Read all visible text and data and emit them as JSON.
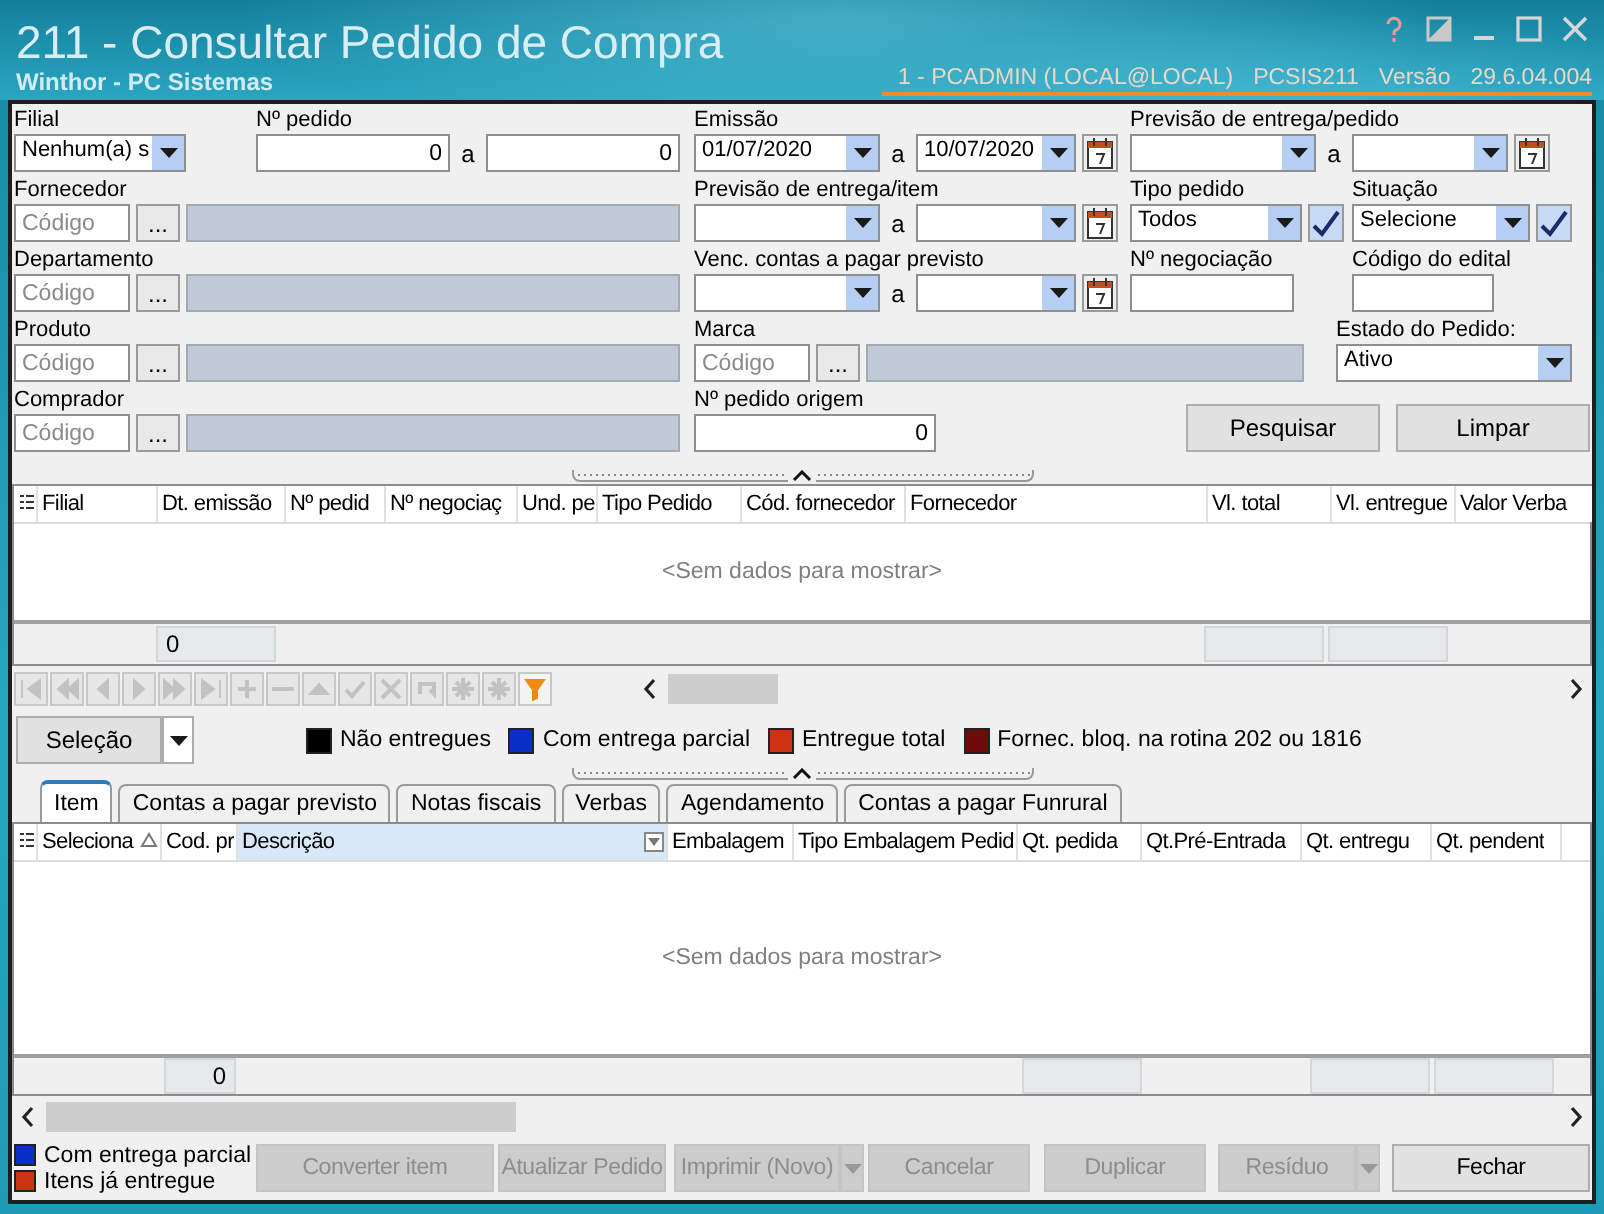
{
  "window": {
    "title": "211 - Consultar Pedido de Compra",
    "subtitle": "Winthor - PC Sistemas",
    "session": "1 - PCADMIN (LOCAL@LOCAL)",
    "program": "PCSIS211",
    "version_label": "Versão",
    "version": "29.6.04.004"
  },
  "filters": {
    "rows": [
      [
        {
          "kind": "combo",
          "label": "Filial",
          "value": "Nenhum(a) s"
        },
        {
          "kind": "number_range",
          "label": "Nº pedido",
          "from": "0",
          "separator": "a",
          "to": "0"
        },
        {
          "kind": "date_range",
          "label": "Emissão",
          "from": "01/07/2020",
          "separator": "a",
          "to": "10/07/2020"
        },
        {
          "kind": "date_range",
          "label": "Previsão de entrega/pedido",
          "separator": "a"
        }
      ],
      [
        {
          "kind": "lookup",
          "label": "Fornecedor",
          "placeholder": "Código",
          "button": "..."
        },
        "",
        {
          "kind": "date_range",
          "label": "Previsão de entrega/item",
          "separator": "a"
        },
        {
          "kind": "combo_check",
          "label": "Tipo pedido",
          "value": "Todos"
        },
        {
          "kind": "combo_check",
          "label": "Situação",
          "value": "Selecione"
        }
      ],
      [
        {
          "kind": "lookup",
          "label": "Departamento",
          "placeholder": "Código",
          "button": "..."
        },
        "",
        {
          "kind": "date_range",
          "label": "Venc. contas a  pagar previsto",
          "separator": "a"
        },
        {
          "kind": "text",
          "label": "Nº negociação"
        },
        {
          "kind": "text",
          "label": "Código do edital"
        }
      ],
      [
        {
          "kind": "lookup",
          "label": "Produto",
          "placeholder": "Código",
          "button": "..."
        },
        "",
        {
          "kind": "lookup",
          "label": "Marca",
          "placeholder": "Código",
          "button": "..."
        },
        {
          "kind": "combo",
          "label": "Estado do Pedido:",
          "value": "Ativo"
        }
      ],
      [
        {
          "kind": "lookup",
          "label": "Comprador",
          "placeholder": "Código",
          "button": "..."
        },
        "",
        {
          "kind": "number",
          "label": "Nº pedido origem",
          "value": "0"
        },
        {
          "kind": "button",
          "label": "Pesquisar"
        },
        {
          "kind": "button",
          "label": "Limpar"
        }
      ]
    ]
  },
  "orders_grid": {
    "columns": [
      "Filial",
      "Dt. emissão",
      "Nº pedid",
      "Nº negociaç",
      "Und. pe",
      "Tipo Pedido",
      "Cód. fornecedor",
      "Fornecedor",
      "Vl. total",
      "Vl. entregue",
      "Valor Verba"
    ],
    "empty_text": "<Sem dados para mostrar>",
    "count": "0"
  },
  "navigator": {
    "buttons": [
      {
        "kind": "first",
        "disabled": true
      },
      {
        "kind": "prior_page",
        "disabled": true
      },
      {
        "kind": "prior",
        "disabled": true
      },
      {
        "kind": "next",
        "disabled": true
      },
      {
        "kind": "next_page",
        "disabled": true
      },
      {
        "kind": "last",
        "disabled": true
      },
      {
        "kind": "insert",
        "disabled": true
      },
      {
        "kind": "delete",
        "disabled": true
      },
      {
        "kind": "edit",
        "disabled": true
      },
      {
        "kind": "post",
        "disabled": true
      },
      {
        "kind": "cancel",
        "disabled": true
      },
      {
        "kind": "refresh",
        "disabled": true
      },
      {
        "kind": "bookmark",
        "disabled": true
      },
      {
        "kind": "goto_bookmark",
        "disabled": true
      },
      {
        "kind": "filter",
        "disabled": false
      }
    ]
  },
  "selection_button": "Seleção",
  "legend": [
    {
      "label": "Não entregues",
      "color": "#000000"
    },
    {
      "label": "Com entrega parcial",
      "color": "#0a2fc8"
    },
    {
      "label": "Entregue total",
      "color": "#cc3311"
    },
    {
      "label": "Fornec. bloq. na rotina 202 ou 1816",
      "color": "#6e0c0c"
    }
  ],
  "tabs": [
    {
      "label": "Item",
      "selected": true
    },
    {
      "label": "Contas a pagar previsto",
      "selected": false
    },
    {
      "label": "Notas fiscais",
      "selected": false
    },
    {
      "label": "Verbas",
      "selected": false
    },
    {
      "label": "Agendamento",
      "selected": false
    },
    {
      "label": "Contas a pagar Funrural",
      "selected": false
    }
  ],
  "items_grid": {
    "columns": [
      {
        "label": "Seleciona",
        "sorted": true,
        "highlighted": false
      },
      {
        "label": "Cod. pr",
        "sorted": false,
        "highlighted": false
      },
      {
        "label": "Descrição",
        "sorted": false,
        "highlighted": true
      },
      {
        "label": "Embalagem",
        "sorted": false,
        "highlighted": false
      },
      {
        "label": "Tipo Embalagem Pedid",
        "sorted": false,
        "highlighted": false
      },
      {
        "label": "Qt. pedida",
        "sorted": false,
        "highlighted": false
      },
      {
        "label": "Qt.Pré-Entrada",
        "sorted": false,
        "highlighted": false
      },
      {
        "label": "Qt. entregu",
        "sorted": false,
        "highlighted": false
      },
      {
        "label": "Qt. pendent",
        "sorted": false,
        "highlighted": false
      }
    ],
    "empty_text": "<Sem dados para mostrar>",
    "count": "0"
  },
  "item_legend": [
    {
      "label": "Com entrega parcial",
      "color": "#0a2fc8"
    },
    {
      "label": "Itens já entregue",
      "color": "#cc3311"
    }
  ],
  "actions": [
    {
      "label": "Converter item",
      "disabled": true,
      "dropdown": false
    },
    {
      "label": "Atualizar Pedido",
      "disabled": true,
      "dropdown": false
    },
    {
      "label": "Imprimir (Novo)",
      "disabled": true,
      "dropdown": true
    },
    {
      "label": "Cancelar",
      "disabled": true,
      "dropdown": false
    },
    {
      "label": "Duplicar",
      "disabled": true,
      "dropdown": false
    },
    {
      "label": "Resíduo",
      "disabled": true,
      "dropdown": true
    },
    {
      "label": "Fechar",
      "disabled": false,
      "dropdown": false
    }
  ]
}
